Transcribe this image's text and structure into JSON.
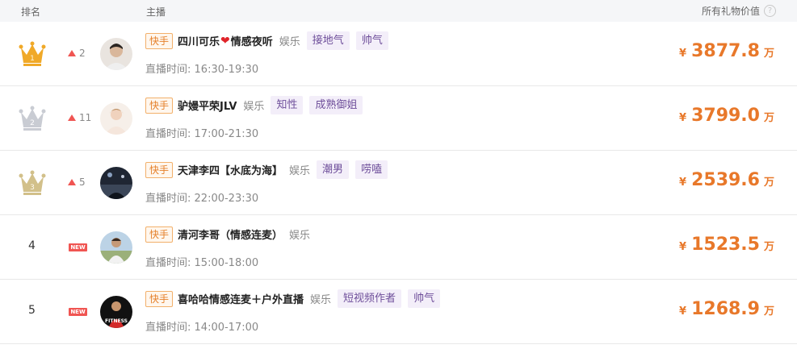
{
  "header": {
    "rank": "排名",
    "anchor": "主播",
    "gift_value": "所有礼物价值",
    "help_icon": "?"
  },
  "colors": {
    "value_orange": "#e8782a",
    "up_red": "#f05552",
    "gold_crown": "#f0a928",
    "silver_crown": "#c9ccd3",
    "bronze_crown": "#d2c08a",
    "tag_bg": "#f3eef9",
    "platform_border": "#f2b06b"
  },
  "rows": [
    {
      "rank": "1",
      "rank_icon": "gold-crown-icon",
      "change": "2",
      "change_type": "up",
      "platform": "快手",
      "name_a": "四川可乐",
      "name_heart": "❤",
      "name_b": "情感夜听",
      "category": "娱乐",
      "tags": [
        "接地气",
        "帅气"
      ],
      "time_label": "直播时间:",
      "time": "16:30-19:30",
      "currency": "¥",
      "amount": "3877.8",
      "unit": "万"
    },
    {
      "rank": "2",
      "rank_icon": "silver-crown-icon",
      "change": "11",
      "change_type": "up",
      "platform": "快手",
      "name": "驴嫚平荣JLV",
      "category": "娱乐",
      "tags": [
        "知性",
        "成熟御姐"
      ],
      "time_label": "直播时间:",
      "time": "17:00-21:30",
      "currency": "¥",
      "amount": "3799.0",
      "unit": "万"
    },
    {
      "rank": "3",
      "rank_icon": "bronze-crown-icon",
      "change": "5",
      "change_type": "up",
      "platform": "快手",
      "name": "天津李四【水底为海】",
      "category": "娱乐",
      "tags": [
        "潮男",
        "唠嗑"
      ],
      "time_label": "直播时间:",
      "time": "22:00-23:30",
      "currency": "¥",
      "amount": "2539.6",
      "unit": "万"
    },
    {
      "rank": "4",
      "change": "NEW",
      "change_type": "new",
      "platform": "快手",
      "name": "清河李哥（情感连麦）",
      "category": "娱乐",
      "tags": [],
      "time_label": "直播时间:",
      "time": "15:00-18:00",
      "currency": "¥",
      "amount": "1523.5",
      "unit": "万"
    },
    {
      "rank": "5",
      "change": "NEW",
      "change_type": "new",
      "platform": "快手",
      "name": "喜哈哈情感连麦＋户外直播",
      "category": "娱乐",
      "tags": [
        "短视频作者",
        "帅气"
      ],
      "avatar_text": "FITNESS",
      "time_label": "直播时间:",
      "time": "14:00-17:00",
      "currency": "¥",
      "amount": "1268.9",
      "unit": "万"
    }
  ]
}
